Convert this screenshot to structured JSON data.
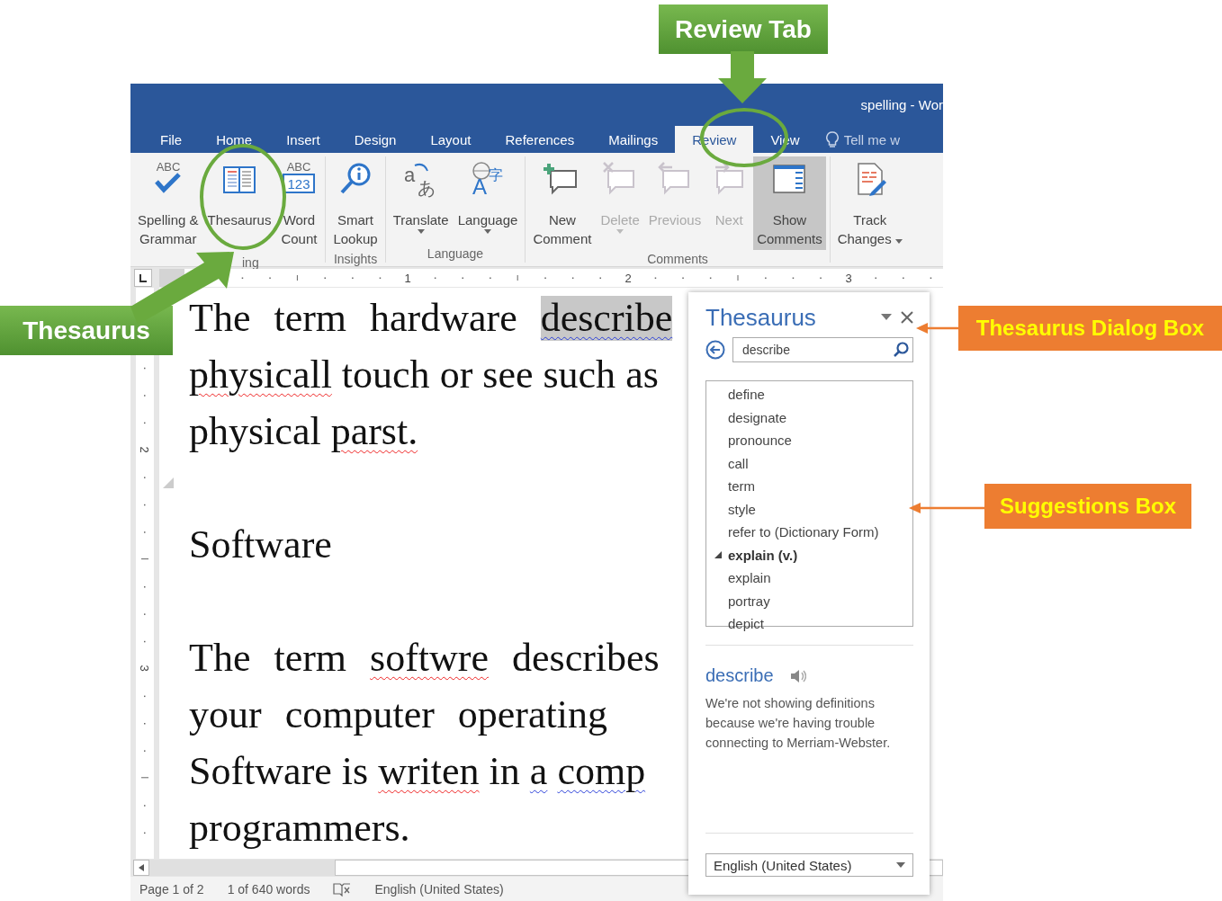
{
  "window": {
    "title": "spelling - Wor"
  },
  "tabs": [
    {
      "label": "File",
      "selected": false
    },
    {
      "label": "Home",
      "selected": false
    },
    {
      "label": "Insert",
      "selected": false
    },
    {
      "label": "Design",
      "selected": false
    },
    {
      "label": "Layout",
      "selected": false
    },
    {
      "label": "References",
      "selected": false
    },
    {
      "label": "Mailings",
      "selected": false
    },
    {
      "label": "Review",
      "selected": true
    },
    {
      "label": "View",
      "selected": false
    }
  ],
  "tell_me": {
    "placeholder": "Tell me w"
  },
  "ribbon": {
    "groups": [
      {
        "label": "ing",
        "buttons": [
          {
            "kind": "spelling",
            "lines": [
              "Spelling &",
              "Grammar"
            ],
            "glyphs": [
              "ABC"
            ],
            "disabled": false,
            "on": false,
            "dropdown": false
          },
          {
            "kind": "thesaurus",
            "lines": [
              "Thesaurus"
            ],
            "disabled": false,
            "on": false,
            "dropdown": false
          },
          {
            "kind": "wordcount",
            "lines": [
              "Word",
              "Count"
            ],
            "glyphs": [
              "ABC",
              "123"
            ],
            "disabled": false,
            "on": false,
            "dropdown": false
          }
        ]
      },
      {
        "label": "Insights",
        "buttons": [
          {
            "kind": "lookup",
            "lines": [
              "Smart",
              "Lookup"
            ],
            "disabled": false,
            "on": false,
            "dropdown": false
          }
        ]
      },
      {
        "label": "Language",
        "buttons": [
          {
            "kind": "translate",
            "lines": [
              "Translate"
            ],
            "glyphs": [
              "a",
              "あ"
            ],
            "disabled": false,
            "on": false,
            "dropdown": true
          },
          {
            "kind": "language",
            "lines": [
              "Language"
            ],
            "glyphs": [
              "A",
              "字"
            ],
            "disabled": false,
            "on": false,
            "dropdown": true
          }
        ]
      },
      {
        "label": "Comments",
        "buttons": [
          {
            "kind": "new-comment",
            "lines": [
              "New",
              "Comment"
            ],
            "disabled": false,
            "on": false,
            "dropdown": false
          },
          {
            "kind": "delete",
            "lines": [
              "Delete"
            ],
            "disabled": true,
            "on": false,
            "dropdown": true
          },
          {
            "kind": "previous",
            "lines": [
              "Previous"
            ],
            "disabled": true,
            "on": false,
            "dropdown": false
          },
          {
            "kind": "next",
            "lines": [
              "Next"
            ],
            "disabled": true,
            "on": false,
            "dropdown": false
          },
          {
            "kind": "show-comments",
            "lines": [
              "Show",
              "Comments"
            ],
            "disabled": false,
            "on": true,
            "dropdown": false
          }
        ]
      },
      {
        "buttons": [
          {
            "kind": "track-changes",
            "lines": [
              "Track",
              "Changes"
            ],
            "disabled": false,
            "on": false,
            "dropdown": true
          }
        ]
      }
    ]
  },
  "ruler": {
    "marks": [
      "1",
      "2",
      "3"
    ],
    "vertical_marks": [
      "2",
      "3"
    ]
  },
  "document": {
    "lines": [
      {
        "kind": "text",
        "justified": true,
        "words": [
          {
            "text": "The",
            "spelling_error": false,
            "grammar_error": false,
            "selected": false
          },
          {
            "text": "term",
            "spelling_error": false,
            "grammar_error": false,
            "selected": false
          },
          {
            "text": "hardware",
            "spelling_error": false,
            "grammar_error": false,
            "selected": false
          },
          {
            "text": "describe",
            "spelling_error": false,
            "grammar_error": true,
            "selected": true
          }
        ]
      },
      {
        "kind": "text",
        "justified": false,
        "words": [
          {
            "text": "physicall",
            "spelling_error": true,
            "grammar_error": false,
            "selected": false
          },
          {
            "text": "touch",
            "spelling_error": false,
            "grammar_error": false,
            "selected": false
          },
          {
            "text": "or",
            "spelling_error": false,
            "grammar_error": false,
            "selected": false
          },
          {
            "text": "see",
            "spelling_error": false,
            "grammar_error": false,
            "selected": false
          },
          {
            "text": "such",
            "spelling_error": false,
            "grammar_error": false,
            "selected": false
          },
          {
            "text": "as",
            "spelling_error": false,
            "grammar_error": false,
            "selected": false
          }
        ]
      },
      {
        "kind": "text",
        "justified": false,
        "words": [
          {
            "text": "physical",
            "spelling_error": false,
            "grammar_error": false,
            "selected": false
          },
          {
            "text": "parst.",
            "spelling_error": true,
            "grammar_error": false,
            "selected": false
          }
        ]
      },
      {
        "kind": "blank"
      },
      {
        "kind": "text",
        "words": [
          {
            "text": "Software",
            "spelling_error": false,
            "grammar_error": false,
            "selected": false
          }
        ]
      },
      {
        "kind": "blank"
      },
      {
        "kind": "text",
        "justified": true,
        "words": [
          {
            "text": "The",
            "spelling_error": false,
            "grammar_error": false,
            "selected": false
          },
          {
            "text": "term",
            "spelling_error": false,
            "grammar_error": false,
            "selected": false
          },
          {
            "text": "softwre",
            "spelling_error": true,
            "grammar_error": false,
            "selected": false
          },
          {
            "text": "describes",
            "spelling_error": false,
            "grammar_error": false,
            "selected": false
          }
        ]
      },
      {
        "kind": "text",
        "justified": true,
        "words": [
          {
            "text": "your",
            "spelling_error": false,
            "grammar_error": false,
            "selected": false
          },
          {
            "text": "computer",
            "spelling_error": false,
            "grammar_error": false,
            "selected": false
          },
          {
            "text": "operating",
            "spelling_error": false,
            "grammar_error": false,
            "selected": false
          }
        ]
      },
      {
        "kind": "text",
        "justified": false,
        "words": [
          {
            "text": "Software",
            "spelling_error": false,
            "grammar_error": false,
            "selected": false
          },
          {
            "text": "is",
            "spelling_error": false,
            "grammar_error": false,
            "selected": false
          },
          {
            "text": "writen",
            "spelling_error": true,
            "grammar_error": false,
            "selected": false
          },
          {
            "text": "in",
            "spelling_error": false,
            "grammar_error": false,
            "selected": false
          },
          {
            "text": "a",
            "spelling_error": false,
            "grammar_error": true,
            "selected": false
          },
          {
            "text": "comp",
            "spelling_error": false,
            "grammar_error": true,
            "selected": false
          }
        ]
      },
      {
        "kind": "text",
        "words": [
          {
            "text": "programmers.",
            "spelling_error": false,
            "grammar_error": false,
            "selected": false
          }
        ]
      }
    ]
  },
  "thesaurus_pane": {
    "title": "Thesaurus",
    "search": {
      "value": "describe"
    },
    "suggestions": [
      {
        "text": "define"
      },
      {
        "text": "designate"
      },
      {
        "text": "pronounce"
      },
      {
        "text": "call"
      },
      {
        "text": "term"
      },
      {
        "text": "style"
      },
      {
        "text": "refer to (Dictionary Form)"
      },
      {
        "text": "explain (v.)",
        "expanded": true,
        "children": [
          {
            "text": "explain"
          },
          {
            "text": "portray"
          },
          {
            "text": "depict"
          }
        ]
      }
    ],
    "definition": {
      "word": "describe",
      "text": "We're not showing definitions because we're having trouble connecting to Merriam-Webster."
    },
    "language": {
      "value": "English (United States)"
    }
  },
  "status_bar": {
    "page": "Page 1 of 2",
    "words": "1 of 640 words",
    "language": "English (United States)"
  },
  "annotations": [
    {
      "kind": "green-callout",
      "text": "Review Tab"
    },
    {
      "kind": "green-callout",
      "text": "Thesaurus"
    },
    {
      "kind": "orange-callout",
      "text": "Thesaurus Dialog Box"
    },
    {
      "kind": "orange-callout",
      "text": "Suggestions Box"
    }
  ]
}
